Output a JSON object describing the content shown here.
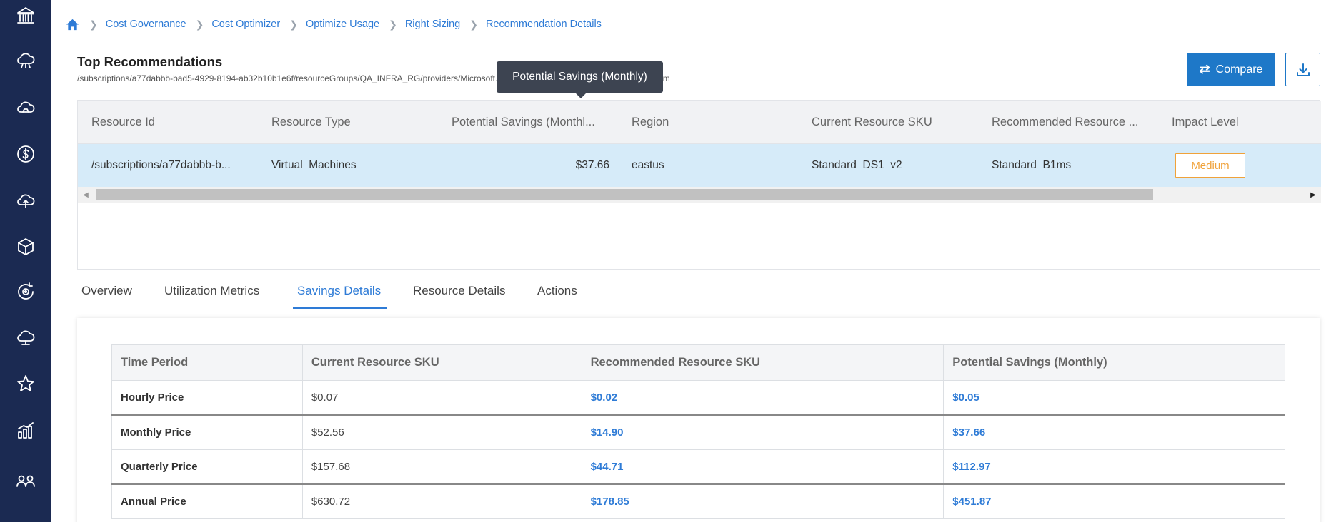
{
  "sidebar": {
    "icons": [
      "bank-icon",
      "cloud-network-icon",
      "cloud-icon",
      "dollar-icon",
      "cloud-upload-icon",
      "cube-icon",
      "gear-cycle-icon",
      "cloud-link-icon",
      "star-icon",
      "bar-chart-icon",
      "users-icon"
    ]
  },
  "breadcrumb": {
    "items": [
      "Cost Governance",
      "Cost Optimizer",
      "Optimize Usage",
      "Right Sizing",
      "Recommendation Details"
    ]
  },
  "page": {
    "title": "Top Recommendations",
    "path": "/subscriptions/a77dabbb-bad5-4929-8194-ab32b10b1e6f/resourceGroups/QA_INFRA_RG/providers/Microsoft.Compute/virtualMachines/testazure-Qa01-vm",
    "compare_label": "Compare"
  },
  "tooltip": {
    "text": "Potential Savings (Monthly)"
  },
  "grid": {
    "headers": [
      "Resource Id",
      "Resource Type",
      "Potential Savings (Monthl...",
      "Region",
      "Current Resource SKU",
      "Recommended Resource ...",
      "Impact Level"
    ],
    "row": {
      "resource_id": "/subscriptions/a77dabbb-b...",
      "resource_type": "Virtual_Machines",
      "potential_savings": "$37.66",
      "region": "eastus",
      "current_sku": "Standard_DS1_v2",
      "recommended_sku": "Standard_B1ms",
      "impact_level": "Medium"
    }
  },
  "tabs": {
    "items": [
      "Overview",
      "Utilization Metrics",
      "Savings Details",
      "Resource Details",
      "Actions"
    ],
    "active": "Savings Details"
  },
  "savings": {
    "headers": [
      "Time Period",
      "Current Resource SKU",
      "Recommended Resource SKU",
      "Potential Savings (Monthly)"
    ],
    "rows": [
      {
        "period": "Hourly Price",
        "current": "$0.07",
        "recommended": "$0.02",
        "savings": "$0.05"
      },
      {
        "period": "Monthly Price",
        "current": "$52.56",
        "recommended": "$14.90",
        "savings": "$37.66"
      },
      {
        "period": "Quarterly Price",
        "current": "$157.68",
        "recommended": "$44.71",
        "savings": "$112.97"
      },
      {
        "period": "Annual Price",
        "current": "$630.72",
        "recommended": "$178.85",
        "savings": "$451.87"
      }
    ]
  },
  "colors": {
    "sidebar": "#1b2a52",
    "accent": "#2e7bd6",
    "primary_button": "#1e78c8",
    "selected_row": "#d6ebf9",
    "medium_badge": "#f0a23a"
  }
}
